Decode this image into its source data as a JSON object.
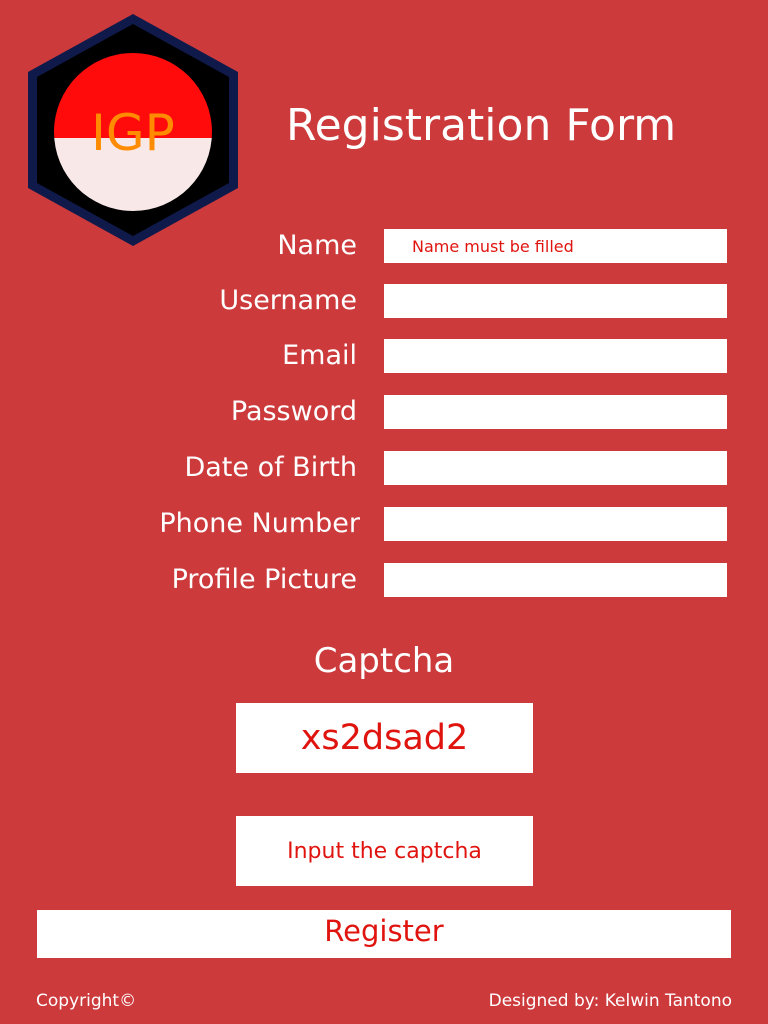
{
  "logo": {
    "text": "IGP",
    "colors": {
      "outer_hex": "#101a4a",
      "inner_hex": "#000000",
      "ball_top": "#ff0b0b",
      "ball_bottom": "#f8e8e8",
      "text": "#ff8c00"
    }
  },
  "page": {
    "title": "Registration Form"
  },
  "form": {
    "fields": [
      {
        "label": "Name",
        "placeholder": "Name must be filled"
      },
      {
        "label": "Username",
        "placeholder": ""
      },
      {
        "label": "Email",
        "placeholder": ""
      },
      {
        "label": "Password",
        "placeholder": ""
      },
      {
        "label": "Date of Birth",
        "placeholder": ""
      },
      {
        "label": "Phone Number",
        "placeholder": ""
      },
      {
        "label": "Profile Picture",
        "placeholder": ""
      }
    ]
  },
  "captcha": {
    "heading": "Captcha",
    "code": "xs2dsad2",
    "input_placeholder": "Input the captcha"
  },
  "register_label": "Register",
  "footer": {
    "copyright": "Copyright©",
    "designer": "Designed by: Kelwin Tantono"
  },
  "colors": {
    "background": "#cc3a3c",
    "accent_text": "#e0140f",
    "field_bg": "#ffffff"
  }
}
